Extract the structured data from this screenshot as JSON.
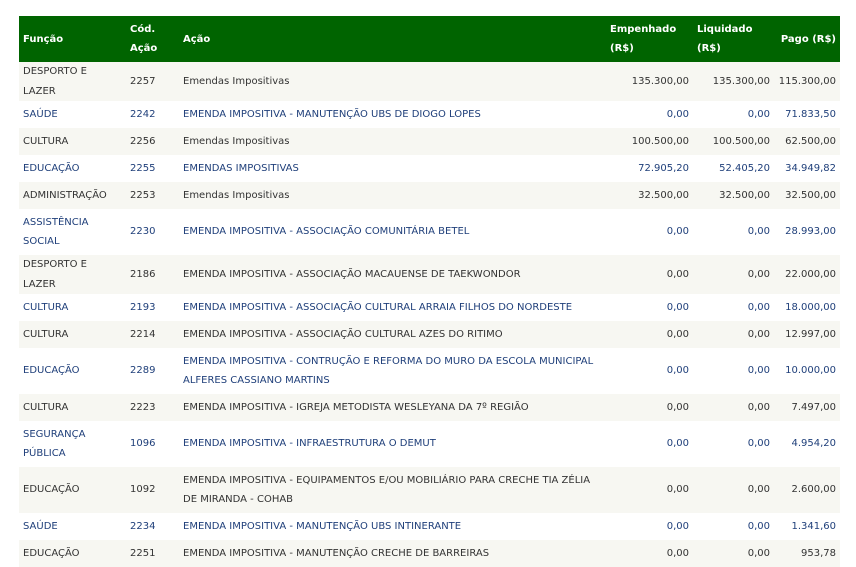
{
  "table": {
    "headers": {
      "funcao": "Função",
      "cod_acao": "Cód. Ação",
      "acao": "Ação",
      "empenhado": "Empenhado (R$)",
      "liquidado": "Liquidado (R$)",
      "pago": "Pago (R$)"
    },
    "rows": [
      {
        "funcao": "DESPORTO E LAZER",
        "cod": "2257",
        "acao": "Emendas Impositivas",
        "empenhado": "135.300,00",
        "liquidado": "135.300,00",
        "pago": "115.300,00"
      },
      {
        "funcao": "SAÚDE",
        "cod": "2242",
        "acao": "EMENDA IMPOSITIVA - MANUTENÇÃO UBS DE DIOGO LOPES",
        "empenhado": "0,00",
        "liquidado": "0,00",
        "pago": "71.833,50"
      },
      {
        "funcao": "CULTURA",
        "cod": "2256",
        "acao": "Emendas Impositivas",
        "empenhado": "100.500,00",
        "liquidado": "100.500,00",
        "pago": "62.500,00"
      },
      {
        "funcao": "EDUCAÇÃO",
        "cod": "2255",
        "acao": "EMENDAS IMPOSITIVAS",
        "empenhado": "72.905,20",
        "liquidado": "52.405,20",
        "pago": "34.949,82"
      },
      {
        "funcao": "ADMINISTRAÇÃO",
        "cod": "2253",
        "acao": "Emendas Impositivas",
        "empenhado": "32.500,00",
        "liquidado": "32.500,00",
        "pago": "32.500,00"
      },
      {
        "funcao": "ASSISTÊNCIA SOCIAL",
        "cod": "2230",
        "acao": "EMENDA IMPOSITIVA - ASSOCIAÇÃO COMUNITÁRIA BETEL",
        "empenhado": "0,00",
        "liquidado": "0,00",
        "pago": "28.993,00"
      },
      {
        "funcao": "DESPORTO E LAZER",
        "cod": "2186",
        "acao": "EMENDA IMPOSITIVA - ASSOCIAÇÃO MACAUENSE DE TAEKWONDOR",
        "empenhado": "0,00",
        "liquidado": "0,00",
        "pago": "22.000,00"
      },
      {
        "funcao": "CULTURA",
        "cod": "2193",
        "acao": "EMENDA IMPOSITIVA - ASSOCIAÇÃO CULTURAL ARRAIA FILHOS DO NORDESTE",
        "empenhado": "0,00",
        "liquidado": "0,00",
        "pago": "18.000,00"
      },
      {
        "funcao": "CULTURA",
        "cod": "2214",
        "acao": "EMENDA IMPOSITIVA - ASSOCIAÇÃO CULTURAL AZES DO RITIMO",
        "empenhado": "0,00",
        "liquidado": "0,00",
        "pago": "12.997,00"
      },
      {
        "funcao": "EDUCAÇÃO",
        "cod": "2289",
        "acao": "EMENDA IMPOSITIVA - CONTRUÇÃO E REFORMA DO MURO DA ESCOLA MUNICIPAL ALFERES CASSIANO MARTINS",
        "empenhado": "0,00",
        "liquidado": "0,00",
        "pago": "10.000,00"
      },
      {
        "funcao": "CULTURA",
        "cod": "2223",
        "acao": "EMENDA IMPOSITIVA - IGREJA METODISTA WESLEYANA DA 7º REGIÃO",
        "empenhado": "0,00",
        "liquidado": "0,00",
        "pago": "7.497,00"
      },
      {
        "funcao": "SEGURANÇA PÚBLICA",
        "cod": "1096",
        "acao": "EMENDA IMPOSITIVA - INFRAESTRUTURA O DEMUT",
        "empenhado": "0,00",
        "liquidado": "0,00",
        "pago": "4.954,20"
      },
      {
        "funcao": "EDUCAÇÃO",
        "cod": "1092",
        "acao": "EMENDA IMPOSITIVA - EQUIPAMENTOS E/OU MOBILIÁRIO PARA CRECHE TIA ZÉLIA DE MIRANDA - COHAB",
        "empenhado": "0,00",
        "liquidado": "0,00",
        "pago": "2.600,00"
      },
      {
        "funcao": "SAÚDE",
        "cod": "2234",
        "acao": "EMENDA IMPOSITIVA - MANUTENÇÃO UBS INTINERANTE",
        "empenhado": "0,00",
        "liquidado": "0,00",
        "pago": "1.341,60"
      },
      {
        "funcao": "EDUCAÇÃO",
        "cod": "2251",
        "acao": "EMENDA IMPOSITIVA - MANUTENÇÃO CRECHE DE BARREIRAS",
        "empenhado": "0,00",
        "liquidado": "0,00",
        "pago": "953,78"
      }
    ]
  }
}
